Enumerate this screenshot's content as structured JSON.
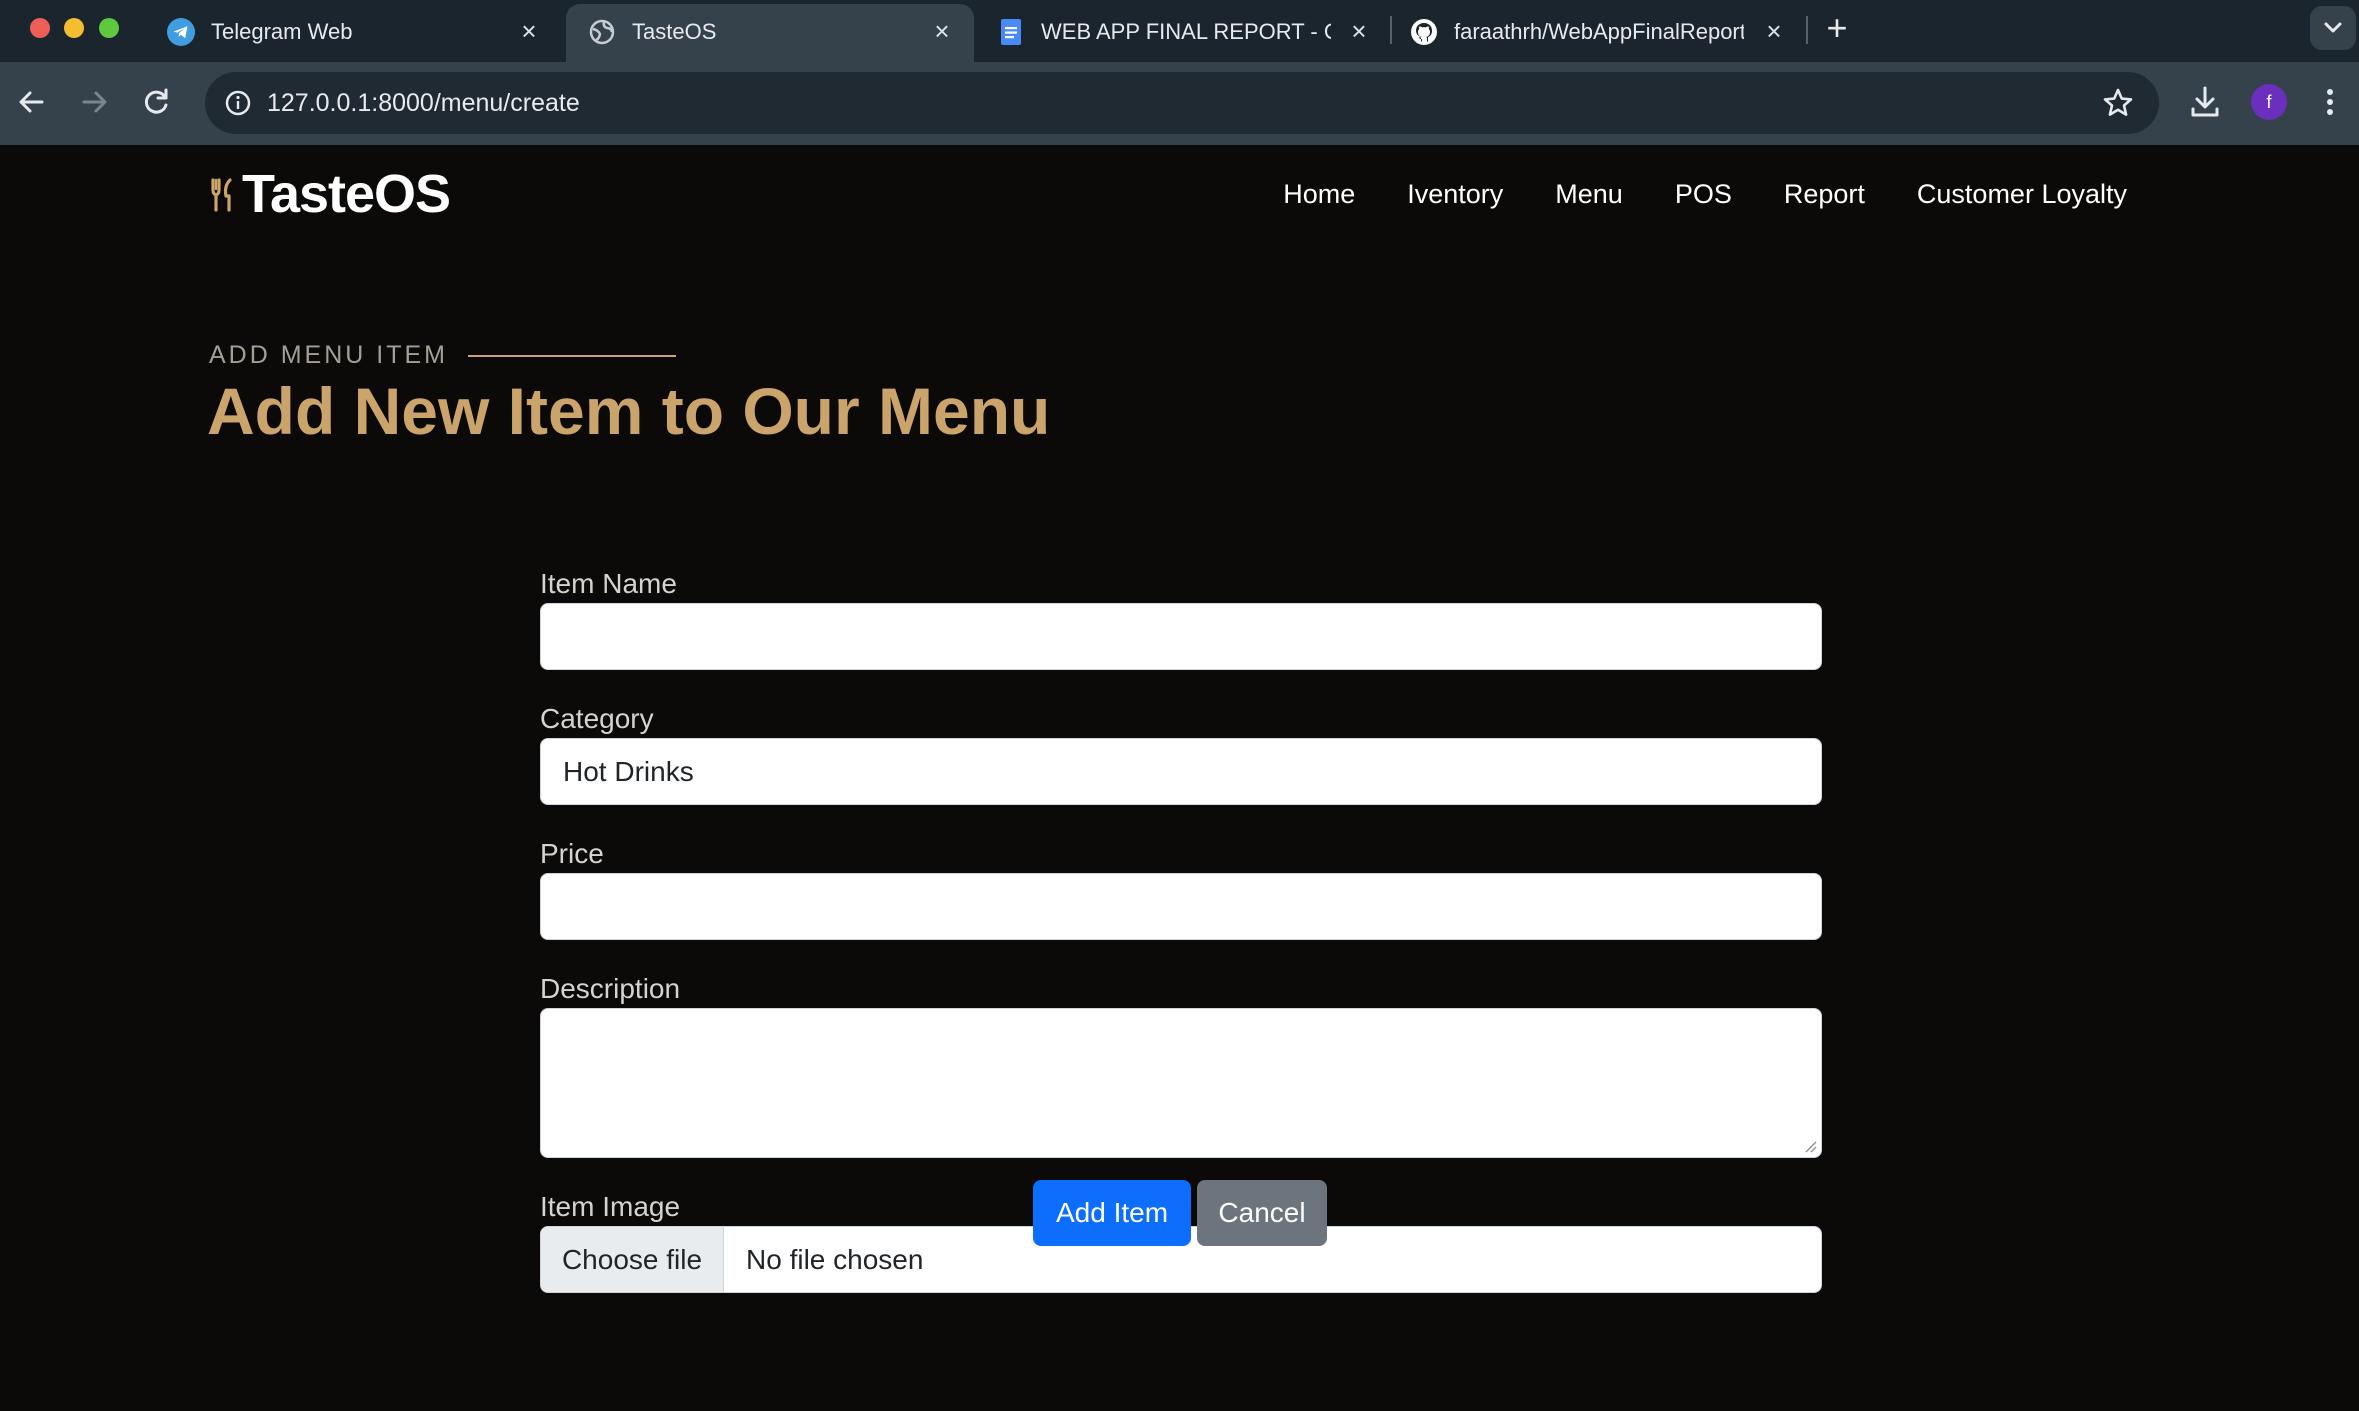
{
  "browser": {
    "tabs": [
      {
        "title": "Telegram Web",
        "icon": "telegram-icon"
      },
      {
        "title": "TasteOS",
        "icon": "globe-icon",
        "active": true
      },
      {
        "title": "WEB APP FINAL REPORT - Go",
        "icon": "docs-icon"
      },
      {
        "title": "faraathrh/WebAppFinalReport",
        "icon": "github-icon"
      }
    ],
    "url": "127.0.0.1:8000/menu/create",
    "profile_initial": "f"
  },
  "site": {
    "brand": "TasteOS",
    "nav": [
      "Home",
      "Iventory",
      "Menu",
      "POS",
      "Report",
      "Customer Loyalty"
    ]
  },
  "section": {
    "eyebrow": "ADD MENU ITEM",
    "heading": "Add New Item to Our Menu"
  },
  "form": {
    "item_name": {
      "label": "Item Name",
      "value": ""
    },
    "category": {
      "label": "Category",
      "value": "Hot Drinks"
    },
    "price": {
      "label": "Price",
      "value": ""
    },
    "description": {
      "label": "Description",
      "value": ""
    },
    "image": {
      "label": "Item Image",
      "button": "Choose file",
      "status": "No file chosen"
    },
    "submit": "Add Item",
    "cancel": "Cancel"
  },
  "colors": {
    "accent_gold": "#caa46b",
    "primary_button": "#0d6efd",
    "secondary_button": "#6c757d",
    "page_background": "#0b0a09"
  }
}
